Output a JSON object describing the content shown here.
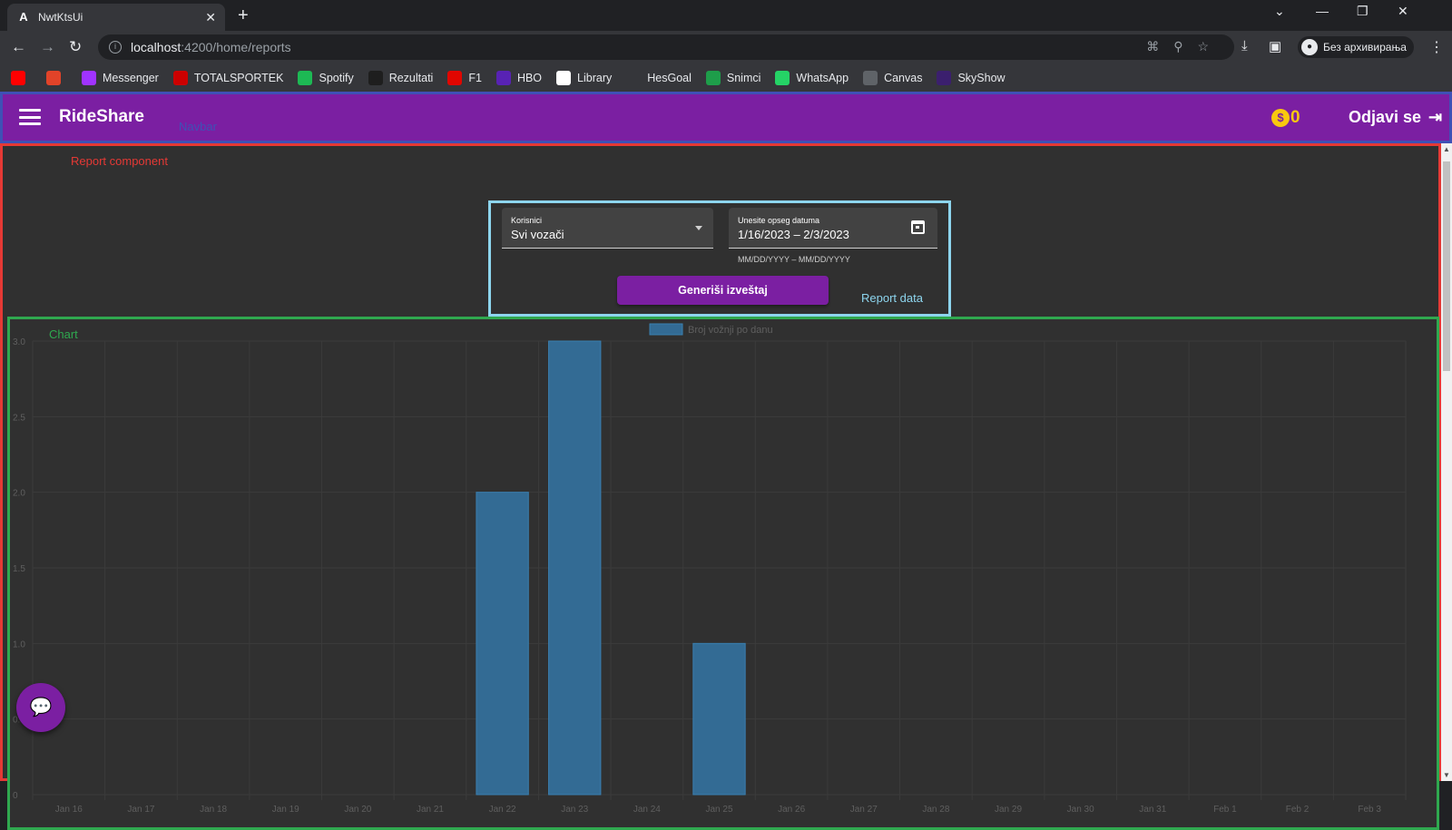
{
  "browser": {
    "tab_title": "NwtKtsUi",
    "tab_favicon": "A",
    "url_host": "localhost",
    "url_path": ":4200/home/reports",
    "profile_label": "Без архивирања",
    "bookmarks": [
      {
        "label": "",
        "icon": "youtube-icon",
        "color": "#ff0000"
      },
      {
        "label": "",
        "icon": "gitlab-icon",
        "color": "#e24329"
      },
      {
        "label": "Messenger",
        "icon": "messenger-icon",
        "color": "#a033ff"
      },
      {
        "label": "TOTALSPORTEK",
        "icon": "totalsportek-icon",
        "color": "#cc0000"
      },
      {
        "label": "Spotify",
        "icon": "spotify-icon",
        "color": "#1db954"
      },
      {
        "label": "Rezultati",
        "icon": "rezultati-icon",
        "color": "#1e1e1e"
      },
      {
        "label": "F1",
        "icon": "f1-icon",
        "color": "#e10600"
      },
      {
        "label": "HBO",
        "icon": "hbo-icon",
        "color": "#5822b4"
      },
      {
        "label": "Library",
        "icon": "library-icon",
        "color": "#ffffff"
      },
      {
        "label": "HesGoal",
        "icon": "hesgoal-icon",
        "color": "#35363a"
      },
      {
        "label": "Snimci",
        "icon": "snimci-icon",
        "color": "#1e9e4a"
      },
      {
        "label": "WhatsApp",
        "icon": "whatsapp-icon",
        "color": "#25d366"
      },
      {
        "label": "Canvas",
        "icon": "canvas-icon",
        "color": "#5f6368"
      },
      {
        "label": "SkyShow",
        "icon": "skyshow-icon",
        "color": "#3b1f6e"
      }
    ]
  },
  "navbar": {
    "brand": "RideShare",
    "label": "Navbar",
    "coin_symbol": "$",
    "coin_value": "0",
    "logout_label": "Odjavi se",
    "background": "#7b1fa2"
  },
  "report": {
    "label": "Report component",
    "data_label": "Report data",
    "users_field": {
      "label": "Korisnici",
      "value": "Svi vozači"
    },
    "date_field": {
      "label": "Unesite opseg datuma",
      "value": "1/16/2023 – 2/3/2023",
      "hint": "MM/DD/YYYY – MM/DD/YYYY"
    },
    "generate_button": "Generiši izveštaj"
  },
  "chart_label": "Chart",
  "chart_data": {
    "type": "bar",
    "series": [
      {
        "name": "Broj vožnji po danu",
        "color": "#336b94"
      }
    ],
    "categories": [
      "Jan 16",
      "Jan 17",
      "Jan 18",
      "Jan 19",
      "Jan 20",
      "Jan 21",
      "Jan 22",
      "Jan 23",
      "Jan 24",
      "Jan 25",
      "Jan 26",
      "Jan 27",
      "Jan 28",
      "Jan 29",
      "Jan 30",
      "Jan 31",
      "Feb 1",
      "Feb 2",
      "Feb 3"
    ],
    "values": [
      0,
      0,
      0,
      0,
      0,
      0,
      2,
      3,
      0,
      1,
      0,
      0,
      0,
      0,
      0,
      0,
      0,
      0,
      0
    ],
    "yticks": [
      "0",
      "0.5",
      "1.0",
      "1.5",
      "2.0",
      "2.5",
      "3.0"
    ],
    "ylim": [
      0,
      3
    ],
    "grid": true,
    "legend": "top-center"
  }
}
